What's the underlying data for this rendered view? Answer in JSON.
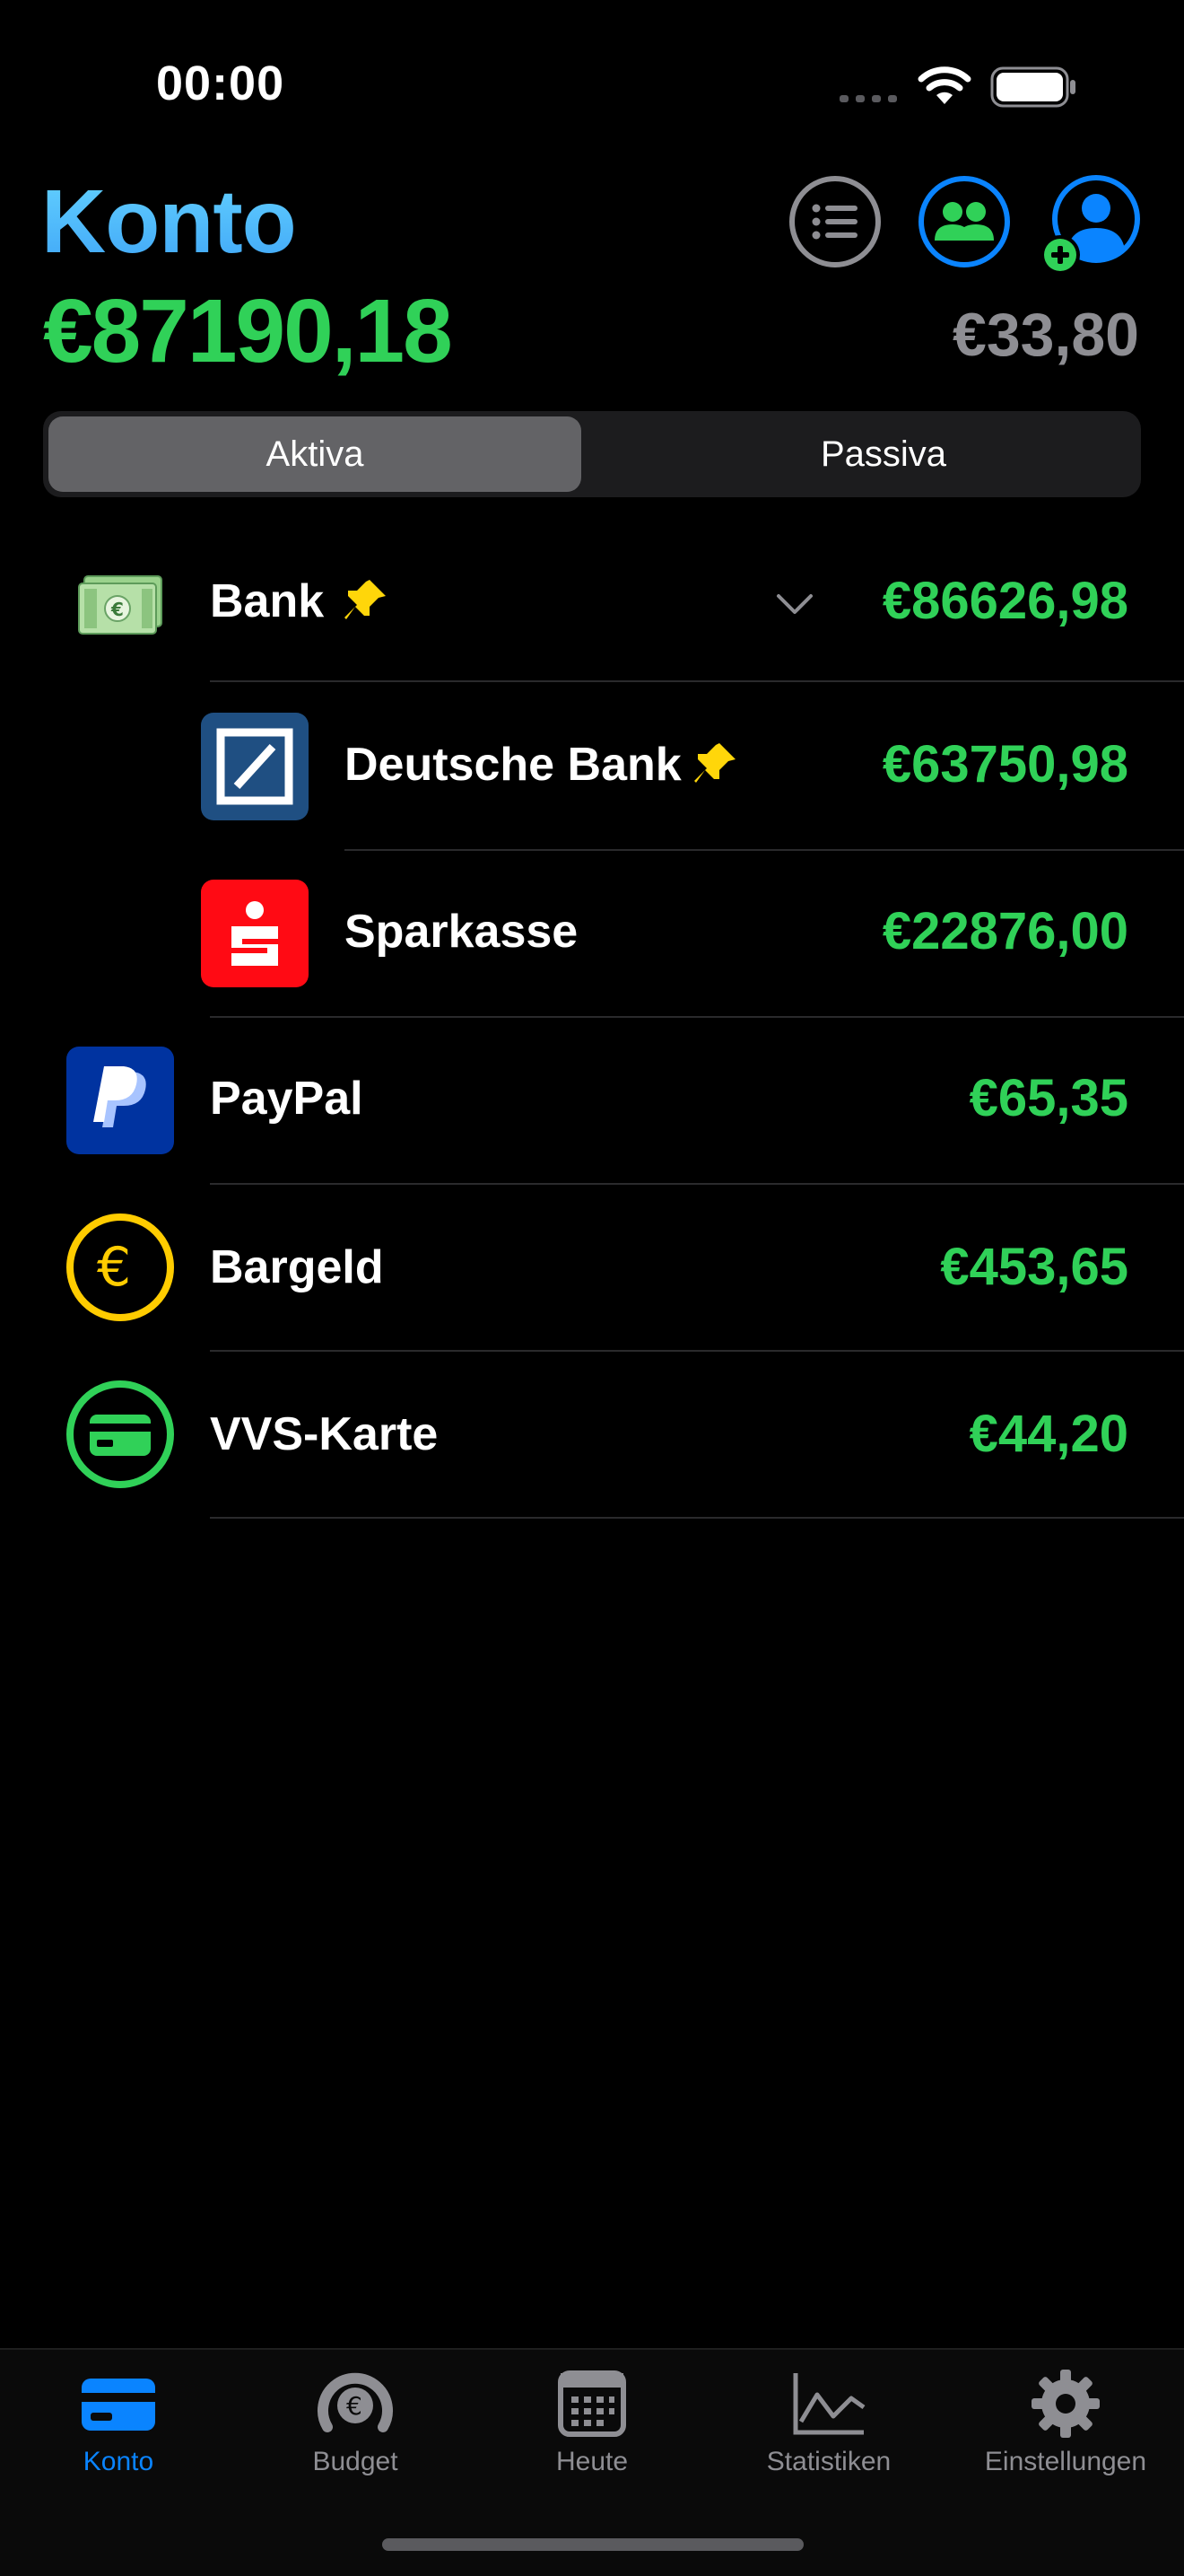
{
  "status_bar": {
    "time": "00:00"
  },
  "header": {
    "title": "Konto",
    "total": "€87190,18",
    "secondary_total": "€33,80",
    "icons": [
      "list-icon",
      "group-icon",
      "add-user-icon"
    ]
  },
  "segmented": {
    "active": "Aktiva",
    "inactive": "Passiva"
  },
  "accounts": {
    "bank": {
      "name": "Bank",
      "amount": "€86626,98",
      "pinned": true,
      "expanded": true
    },
    "deutsche_bank": {
      "name": "Deutsche Bank",
      "amount": "€63750,98",
      "pinned": true
    },
    "sparkasse": {
      "name": "Sparkasse",
      "amount": "€22876,00"
    },
    "paypal": {
      "name": "PayPal",
      "amount": "€65,35"
    },
    "bargeld": {
      "name": "Bargeld",
      "amount": "€453,65"
    },
    "vvs": {
      "name": "VVS-Karte",
      "amount": "€44,20"
    }
  },
  "tabbar": {
    "tabs": [
      {
        "label": "Konto",
        "icon": "card-icon",
        "active": true
      },
      {
        "label": "Budget",
        "icon": "budget-gauge-icon",
        "active": false
      },
      {
        "label": "Heute",
        "icon": "calendar-icon",
        "active": false
      },
      {
        "label": "Statistiken",
        "icon": "chart-icon",
        "active": false
      },
      {
        "label": "Einstellungen",
        "icon": "gear-icon",
        "active": false
      }
    ]
  },
  "colors": {
    "accent_blue": "#0a84ff",
    "title_blue": "#5ac8fa",
    "amount_green": "#30d158",
    "secondary_gray": "#8e8e93",
    "pin_yellow": "#ffd60a"
  }
}
